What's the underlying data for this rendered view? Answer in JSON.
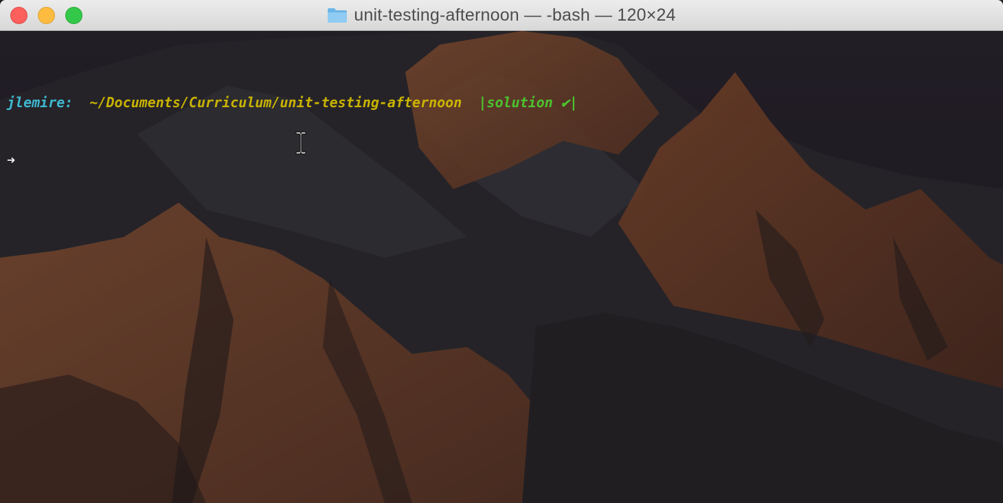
{
  "window": {
    "title": "unit-testing-afternoon — -bash — 120×24",
    "title_icon": "folder-icon",
    "controls": [
      "close-button",
      "minimize-button",
      "maximize-button"
    ]
  },
  "terminal": {
    "prompt_user": "jlemire:",
    "prompt_path": "~/Documents/Curriculum/unit-testing-afternoon",
    "prompt_branch": "|solution ✔|",
    "prompt_arrow": "➜",
    "cursor": "ibeam-cursor-icon"
  },
  "colors": {
    "user": "#3fb8d0",
    "path": "#c9b300",
    "branch": "#4cc22e",
    "close": "#fc605c",
    "minimize": "#fdbc40",
    "maximize": "#34c84a"
  }
}
